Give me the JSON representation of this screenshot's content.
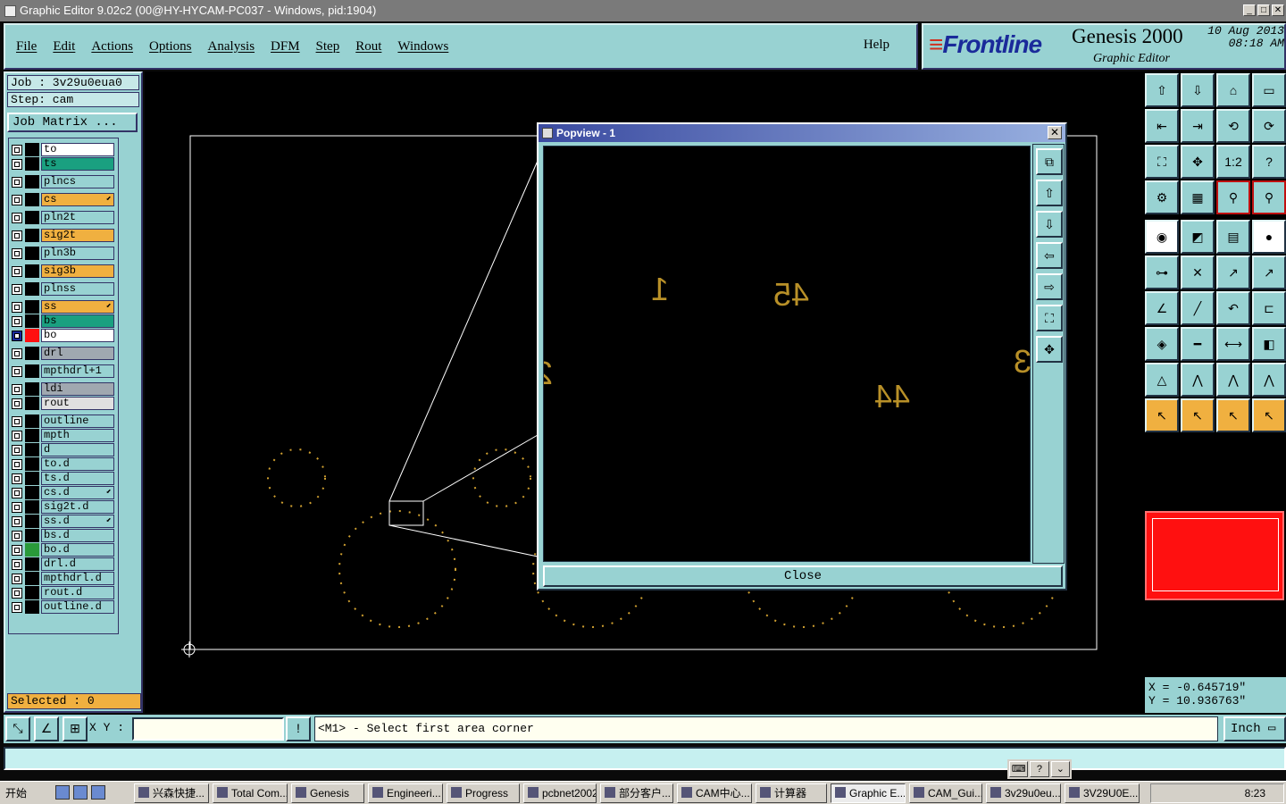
{
  "window": {
    "title": "Graphic Editor 9.02c2 (00@HY-HYCAM-PC037 - Windows, pid:1904)"
  },
  "menu": {
    "items": [
      "File",
      "Edit",
      "Actions",
      "Options",
      "Analysis",
      "DFM",
      "Step",
      "Rout",
      "Windows"
    ],
    "help": "Help"
  },
  "brand": {
    "logo": "Frontline",
    "product": "Genesis 2000",
    "subtitle": "Graphic Editor",
    "date": "10 Aug 2013",
    "time": "08:18 AM"
  },
  "job": {
    "job_line": "Job : 3v29u0eua0",
    "step_line": "Step: cam",
    "matrix_button": "Job Matrix ..."
  },
  "layers": [
    {
      "name": "to",
      "color": "#ffffff"
    },
    {
      "name": "ts",
      "color": "#1aa080"
    },
    {
      "name": "plncs",
      "color": "#98d2d2"
    },
    {
      "name": "cs",
      "color": "#f0b040",
      "mark": "⬋"
    },
    {
      "name": "pln2t",
      "color": "#98d2d2"
    },
    {
      "name": "sig2t",
      "color": "#f0b040"
    },
    {
      "name": "pln3b",
      "color": "#98d2d2"
    },
    {
      "name": "sig3b",
      "color": "#f0b040"
    },
    {
      "name": "plnss",
      "color": "#98d2d2"
    },
    {
      "name": "ss",
      "color": "#f0b040",
      "mark": "⬋"
    },
    {
      "name": "bs",
      "color": "#1aa080"
    },
    {
      "name": "bo",
      "color": "#ffffff",
      "active": true,
      "swatch": "#ff1010"
    },
    {
      "name": "drl",
      "color": "#a0a8b0"
    },
    {
      "name": "mpthdrl+1",
      "color": "#98d2d2"
    },
    {
      "name": "ldi",
      "color": "#a0a8b0"
    },
    {
      "name": "rout",
      "color": "#e0e0e0"
    },
    {
      "name": "outline",
      "color": "#98d2d2"
    },
    {
      "name": "mpth",
      "color": "#98d2d2"
    },
    {
      "name": "d",
      "color": "#98d2d2"
    },
    {
      "name": "to.d",
      "color": "#98d2d2"
    },
    {
      "name": "ts.d",
      "color": "#98d2d2"
    },
    {
      "name": "cs.d",
      "color": "#98d2d2",
      "mark": "⬋"
    },
    {
      "name": "sig2t.d",
      "color": "#98d2d2"
    },
    {
      "name": "ss.d",
      "color": "#98d2d2",
      "mark": "⬋"
    },
    {
      "name": "bs.d",
      "color": "#98d2d2"
    },
    {
      "name": "bo.d",
      "color": "#98d2d2",
      "swatch": "#2a9a3a"
    },
    {
      "name": "drl.d",
      "color": "#98d2d2"
    },
    {
      "name": "mpthdrl.d",
      "color": "#98d2d2"
    },
    {
      "name": "rout.d",
      "color": "#98d2d2"
    },
    {
      "name": "outline.d",
      "color": "#98d2d2"
    }
  ],
  "selected": "Selected : 0",
  "popview": {
    "title": "Popview - 1",
    "close_label": "Close",
    "labels": [
      "1",
      "45",
      "44",
      "3",
      "2"
    ]
  },
  "coords": {
    "x": "X = -0.645719\"",
    "y": "Y = 10.936763\""
  },
  "command": {
    "xy_label": "X Y :",
    "xy_value": "",
    "prompt": "<M1> - Select first area corner",
    "units": "Inch"
  },
  "toolbar_icons": [
    "open-icon",
    "save-icon",
    "home-icon",
    "window-icon",
    "import-icon",
    "export-icon",
    "undo-icon",
    "redo-icon",
    "fit-icon",
    "pan-icon",
    "scale-1to1-icon",
    "help-icon",
    "settings-icon",
    "grid-icon",
    "snap-icon",
    "snap2-icon",
    "pad-icon",
    "edit-icon",
    "ruler-icon",
    "dot-icon",
    "connect-icon",
    "delete-icon",
    "move-icon",
    "copy-icon",
    "angle-icon",
    "line-icon",
    "arc-icon",
    "mirror-icon",
    "add-pad-icon",
    "hline-icon",
    "dim-icon",
    "shapes-icon",
    "triangle-icon",
    "poly-icon",
    "arc-text-icon",
    "tri2-icon",
    "select-icon",
    "select2-icon",
    "select3-icon",
    "select4-icon"
  ],
  "onebyone": "1:2",
  "taskbar": {
    "start": "开始",
    "tasks": [
      "兴森快捷...",
      "Total Com...",
      "Genesis",
      "Engineeri...",
      "Progress",
      "pcbnet2002",
      "部分客户...",
      "CAM中心...",
      "计算器",
      "Graphic E...",
      "CAM_Gui...",
      "3v29u0eu...",
      "3V29U0E..."
    ],
    "clock": "8:23"
  }
}
